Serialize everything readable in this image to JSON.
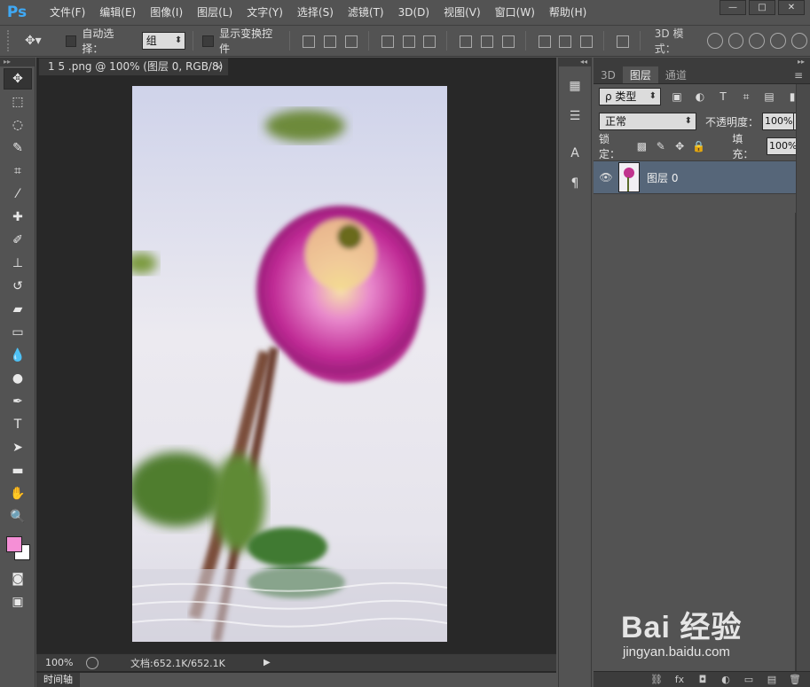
{
  "app": {
    "logo": "Ps"
  },
  "menu": [
    "文件(F)",
    "编辑(E)",
    "图像(I)",
    "图层(L)",
    "文字(Y)",
    "选择(S)",
    "滤镜(T)",
    "3D(D)",
    "视图(V)",
    "窗口(W)",
    "帮助(H)"
  ],
  "window_controls": [
    "minimize",
    "maximize",
    "close"
  ],
  "options": {
    "auto_select_label": "自动选择：",
    "auto_select_value": "组",
    "show_transform_label": "显示变换控件",
    "mode_3d_label": "3D 模式："
  },
  "document": {
    "tab_title": "1 5 .png @ 100% (图层 0, RGB/8)",
    "tab_close": "×",
    "zoom": "100%",
    "doc_size": "文档:652.1K/652.1K",
    "status_arrow": "▶"
  },
  "timeline": {
    "label": "时间轴"
  },
  "panel": {
    "collapse_left": "◂◂",
    "collapse_right": "▸▸",
    "tabs": [
      "3D",
      "图层",
      "通道"
    ],
    "active_tab": "图层",
    "filter_type": "ρ 类型",
    "blend_mode": "正常",
    "opacity_label": "不透明度：",
    "opacity_value": "100%",
    "lock_label": "锁定：",
    "fill_label": "填充：",
    "fill_value": "100%",
    "layers": [
      {
        "name": "图层 0",
        "visible": true
      }
    ],
    "bottom_icons": [
      "link-icon",
      "fx-icon",
      "mask-icon",
      "adjustment-icon",
      "folder-icon",
      "new-layer-icon",
      "trash-icon"
    ]
  },
  "colors": {
    "foreground": "#f58fd6",
    "background": "#ffffff",
    "accent": "#3fa9f5",
    "selected_layer": "#566679"
  },
  "watermark": {
    "logo": "Bai 经验",
    "url": "jingyan.baidu.com"
  }
}
